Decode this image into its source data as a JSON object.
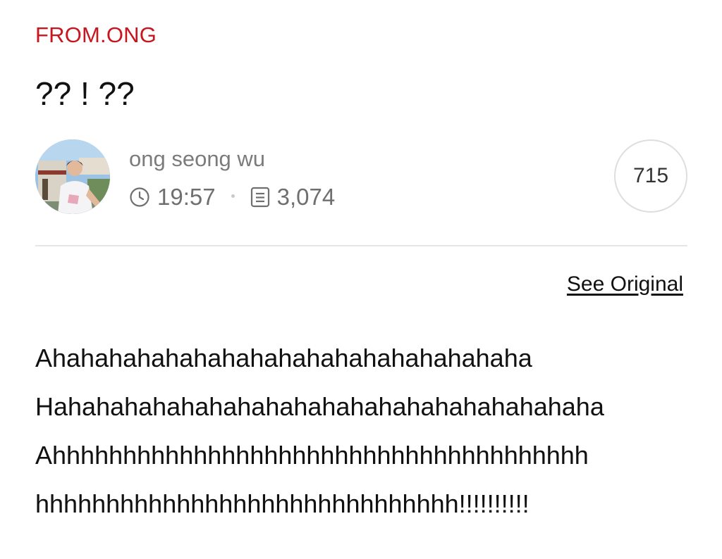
{
  "post": {
    "channel": "FROM.ONG",
    "title": "?? ! ??",
    "author": "ong seong wu",
    "time": "19:57",
    "views": "3,074",
    "likes": "715",
    "see_original": "See Original",
    "body_lines": [
      "Ahahahahahahahahahahahahahahahahaha",
      "Hahahahahahahahahahahahahahahahahahahaha",
      "Ahhhhhhhhhhhhhhhhhhhhhhhhhhhhhhhhhhhhhh",
      "hhhhhhhhhhhhhhhhhhhhhhhhhhhhhh!!!!!!!!!!"
    ]
  },
  "icons": {
    "time": "clock-icon",
    "views": "document-list-icon"
  },
  "colors": {
    "channel": "#c8161e",
    "meta_text": "#6f6f6f",
    "divider": "#e6e6e6",
    "likes_border": "#dedede"
  }
}
